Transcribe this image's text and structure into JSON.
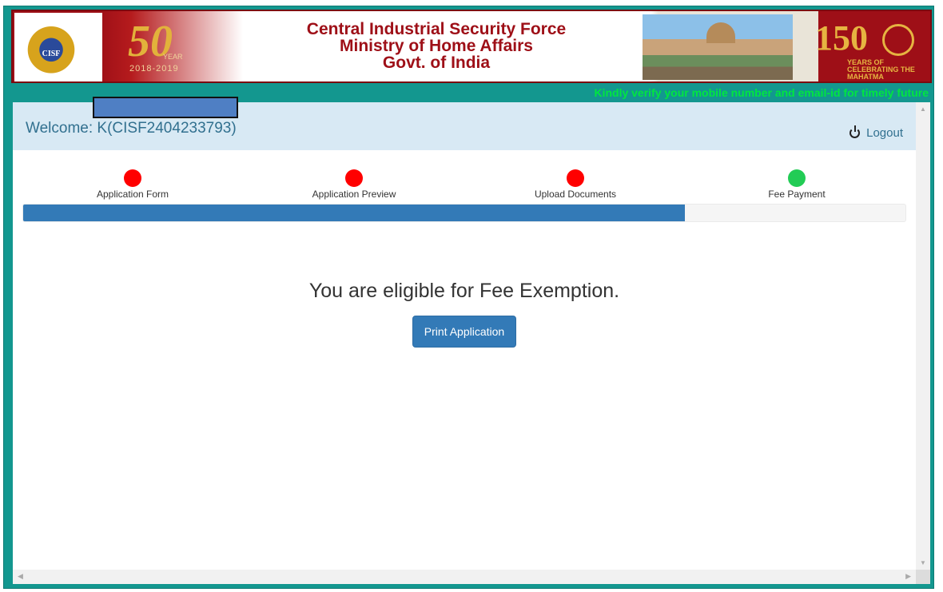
{
  "banner": {
    "emblem_text": "CISF",
    "fifty_number": "50",
    "fifty_year": "YEAR",
    "fifty_range": "2018-2019",
    "title_lines": [
      "Central Industrial Security Force",
      "Ministry of Home Affairs",
      "Govt. of India"
    ],
    "gandhi_number": "150",
    "gandhi_text": "YEARS OF CELEBRATING THE MAHATMA"
  },
  "marquee": "Kindly verify your mobile number and email-id for timely future",
  "welcome": {
    "text": "Welcome: K(CISF2404233793)",
    "logout_label": "Logout"
  },
  "steps": [
    {
      "label": "Application Form",
      "status": "red"
    },
    {
      "label": "Application Preview",
      "status": "red"
    },
    {
      "label": "Upload Documents",
      "status": "red"
    },
    {
      "label": "Fee Payment",
      "status": "green"
    }
  ],
  "progress_percent": 75,
  "message": "You are eligible for Fee Exemption.",
  "print_button_label": "Print Application",
  "colors": {
    "teal_frame": "#13978f",
    "banner_red": "#9e0f17",
    "primary_blue": "#337ab7",
    "marquee_green": "#00e640"
  }
}
